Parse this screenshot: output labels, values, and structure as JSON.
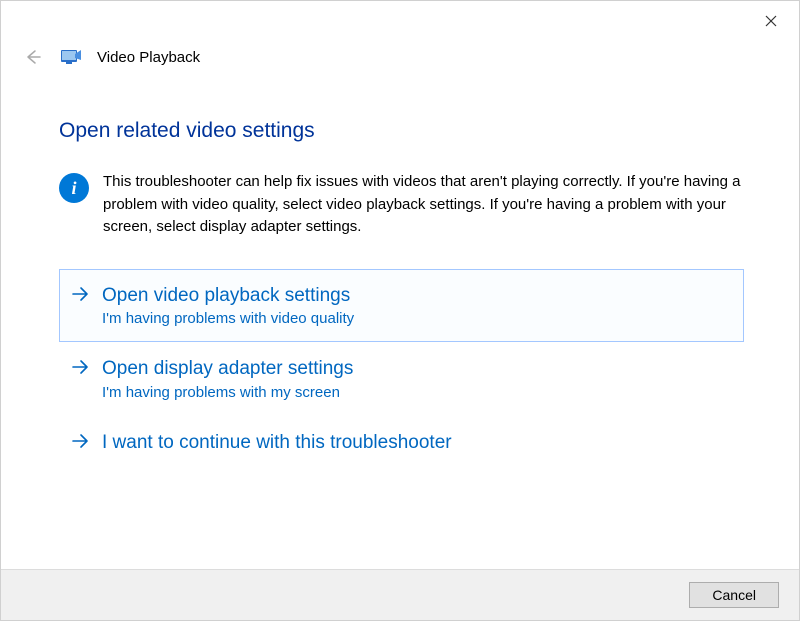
{
  "header": {
    "app_title": "Video Playback"
  },
  "content": {
    "heading": "Open related video settings",
    "info_text": "This troubleshooter can help fix issues with videos that aren't playing correctly. If you're having a problem with video quality, select video playback settings. If you're having a problem with your screen, select display adapter settings."
  },
  "options": [
    {
      "title": "Open video playback settings",
      "subtitle": "I'm having problems with video quality",
      "selected": true
    },
    {
      "title": "Open display adapter settings",
      "subtitle": "I'm having problems with my screen",
      "selected": false
    },
    {
      "title": "I want to continue with this troubleshooter",
      "subtitle": "",
      "selected": false
    }
  ],
  "footer": {
    "cancel_label": "Cancel"
  },
  "colors": {
    "accent": "#0067c0",
    "heading": "#003399",
    "info_bg": "#0078d7"
  }
}
